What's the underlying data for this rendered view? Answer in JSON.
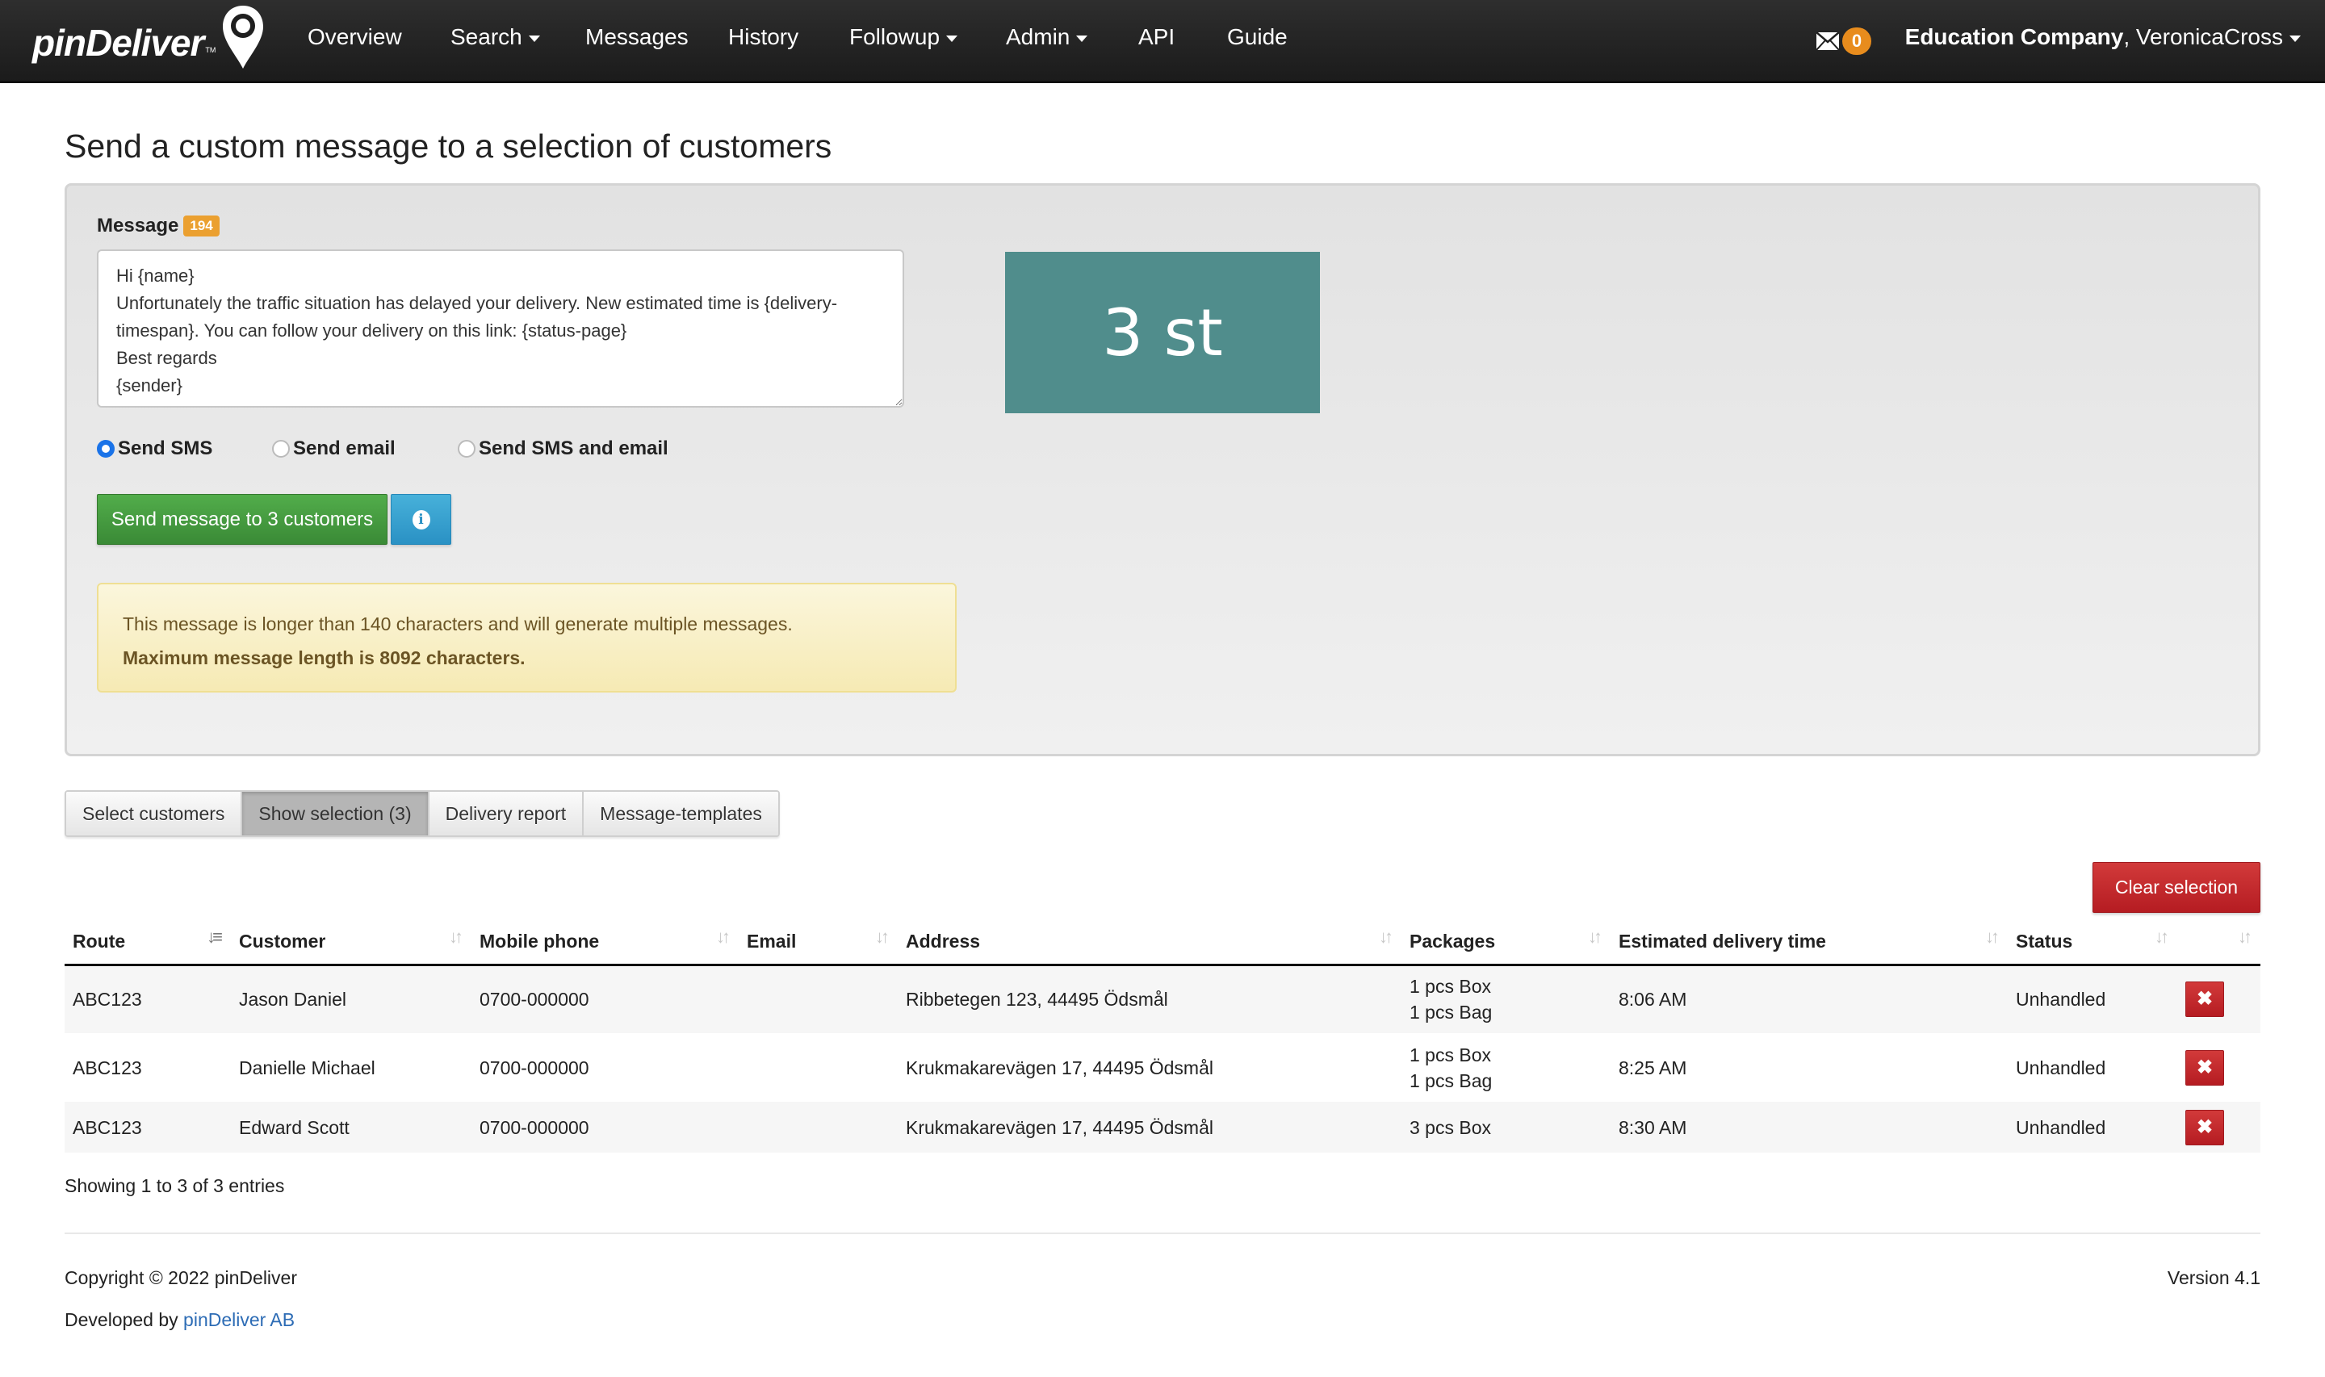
{
  "brand": {
    "name": "pinDeliver",
    "tm": "TM"
  },
  "nav": {
    "items": [
      {
        "label": "Overview",
        "dropdown": false
      },
      {
        "label": "Search",
        "dropdown": true
      },
      {
        "label": "Messages",
        "dropdown": false
      },
      {
        "label": "History",
        "dropdown": false
      },
      {
        "label": "Followup",
        "dropdown": true
      },
      {
        "label": "Admin",
        "dropdown": true
      },
      {
        "label": "API",
        "dropdown": false
      },
      {
        "label": "Guide",
        "dropdown": false
      }
    ],
    "mail_count": "0",
    "company": "Education Company",
    "user": ", VeronicaCross"
  },
  "page": {
    "title": "Send a custom message to a selection of customers"
  },
  "composer": {
    "message_label": "Message",
    "char_count": "194",
    "message_text": "Hi {name}\nUnfortunately the traffic situation has delayed your delivery. New estimated time is {delivery-timespan}. You can follow your delivery on this link: {status-page}\nBest regards\n{sender}",
    "send_options": [
      {
        "label": "Send SMS",
        "checked": true
      },
      {
        "label": "Send email",
        "checked": false
      },
      {
        "label": "Send SMS and email",
        "checked": false
      }
    ],
    "send_button": "Send message to 3 customers",
    "info_icon": "i",
    "alert_line1": "This message is longer than 140 characters and will generate multiple messages.",
    "alert_line2": "Maximum message length is 8092 characters.",
    "recipient_count": "3 st"
  },
  "tabs": [
    {
      "label": "Select customers",
      "active": false
    },
    {
      "label": "Show selection (3)",
      "active": true
    },
    {
      "label": "Delivery report",
      "active": false
    },
    {
      "label": "Message-templates",
      "active": false
    }
  ],
  "clear_selection": "Clear selection",
  "table": {
    "columns": [
      "Route",
      "Customer",
      "Mobile phone",
      "Email",
      "Address",
      "Packages",
      "Estimated delivery time",
      "Status",
      ""
    ],
    "rows": [
      {
        "route": "ABC123",
        "customer": "Jason Daniel",
        "phone": "0700-000000",
        "email": "",
        "address": "Ribbetegen 123, 44495 Ödsmål",
        "packages": [
          "1 pcs Box",
          "1 pcs Bag"
        ],
        "time": "8:06 AM",
        "status": "Unhandled"
      },
      {
        "route": "ABC123",
        "customer": "Danielle Michael",
        "phone": "0700-000000",
        "email": "",
        "address": "Krukmakarevägen 17, 44495 Ödsmål",
        "packages": [
          "1 pcs Box",
          "1 pcs Bag"
        ],
        "time": "8:25 AM",
        "status": "Unhandled"
      },
      {
        "route": "ABC123",
        "customer": "Edward Scott",
        "phone": "0700-000000",
        "email": "",
        "address": "Krukmakarevägen 17, 44495 Ödsmål",
        "packages": [
          "3 pcs Box"
        ],
        "time": "8:30 AM",
        "status": "Unhandled"
      }
    ],
    "remove_icon": "✖",
    "entries_info": "Showing 1 to 3 of 3 entries"
  },
  "footer": {
    "copyright": "Copyright © 2022 pinDeliver",
    "developed_prefix": "Developed by ",
    "developed_link": "pinDeliver AB",
    "version": "Version 4.1"
  },
  "colors": {
    "accent_teal": "#508d8c",
    "badge_orange": "#e88c1d",
    "success_green": "#3a8a36",
    "danger_red": "#b51c22",
    "info_blue": "#2a91c4",
    "link_blue": "#2d6cb5"
  }
}
